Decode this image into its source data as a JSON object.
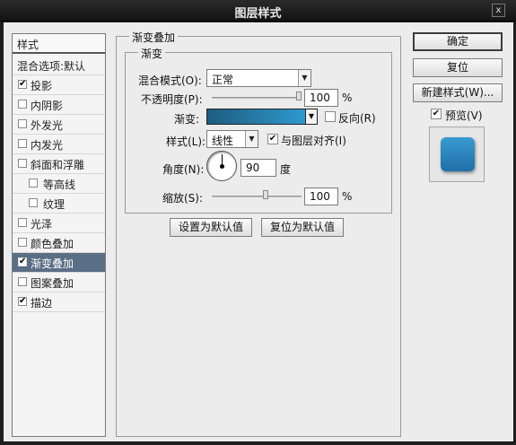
{
  "window": {
    "title": "图层样式",
    "close_glyph": "x"
  },
  "style_list": {
    "header": "样式",
    "blend_options": "混合选项:默认",
    "items": [
      {
        "label": "投影",
        "checked": "✔"
      },
      {
        "label": "内阴影",
        "checked": ""
      },
      {
        "label": "外发光",
        "checked": ""
      },
      {
        "label": "内发光",
        "checked": ""
      },
      {
        "label": "斜面和浮雕",
        "checked": ""
      },
      {
        "label": "等高线",
        "checked": ""
      },
      {
        "label": "纹理",
        "checked": ""
      },
      {
        "label": "光泽",
        "checked": ""
      },
      {
        "label": "颜色叠加",
        "checked": ""
      },
      {
        "label": "渐变叠加",
        "checked": "✔"
      },
      {
        "label": "图案叠加",
        "checked": ""
      },
      {
        "label": "描边",
        "checked": "✔"
      }
    ]
  },
  "panel": {
    "outer_title": "渐变叠加",
    "inner_title": "渐变",
    "blend_mode_label": "混合模式(O):",
    "blend_mode_value": "正常",
    "opacity_label": "不透明度(P):",
    "opacity_value": "100",
    "opacity_unit": "%",
    "opacity_fraction": 1.0,
    "gradient_label": "渐变:",
    "reverse_label": "反向(R)",
    "style_label": "样式(L):",
    "style_value": "线性",
    "align_label": "与图层对齐(I)",
    "align_checked": "✔",
    "angle_label": "角度(N):",
    "angle_value": "90",
    "angle_unit": "度",
    "scale_label": "缩放(S):",
    "scale_value": "100",
    "scale_unit": "%",
    "scale_fraction": 0.6,
    "set_default_btn": "设置为默认值",
    "reset_default_btn": "复位为默认值"
  },
  "buttons": {
    "ok": "确定",
    "reset": "复位",
    "new_style": "新建样式(W)...",
    "preview_label": "预览(V)",
    "preview_checked": "✔"
  },
  "colors": {
    "gradient_start": "#1f5c80",
    "gradient_end": "#2f9bd0",
    "selected_item": "#5a6e85",
    "preview_swatch": "#2b8cc4"
  },
  "icons": {
    "dropdown_arrow": "▼",
    "check": "✔"
  }
}
